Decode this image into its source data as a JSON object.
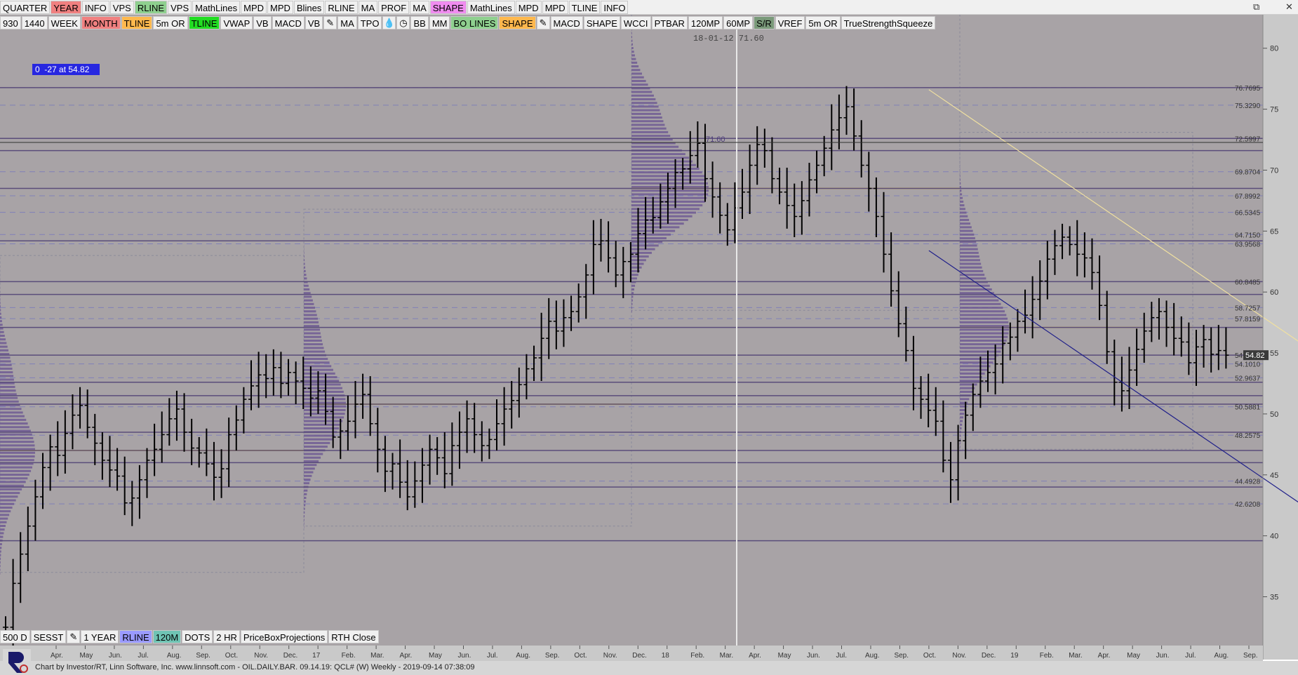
{
  "toolbar_top": [
    "QUARTER",
    "YEAR",
    "INFO",
    "VPS",
    "RLINE",
    "VPS",
    "MathLines",
    "MPD",
    "MPD",
    "Blines",
    "RLINE",
    "MA",
    "PROF",
    "MA",
    "SHAPE",
    "MathLines",
    "MPD",
    "MPD",
    "TLINE",
    "INFO"
  ],
  "toolbar_top_colors": [
    "",
    "red",
    "",
    "",
    "green",
    "",
    "",
    "",
    "",
    "",
    "",
    "",
    "",
    "",
    "magenta",
    "",
    "",
    "",
    "",
    ""
  ],
  "toolbar_second": [
    "930",
    "1440",
    "WEEK",
    "MONTH",
    "TLINE",
    "5m OR",
    "TLINE",
    "VWAP",
    "VB",
    "MACD",
    "VB",
    "pencil-icon",
    "MA",
    "TPO",
    "drop-icon",
    "clock-icon",
    "BB",
    "MM",
    "BO LINES",
    "SHAPE",
    "pencil-icon",
    "MACD",
    "SHAPE",
    "WCCI",
    "PTBAR",
    "120MP",
    "60MP",
    "S/R",
    "VREF",
    "5m OR",
    "TrueStrengthSqueeze"
  ],
  "toolbar_second_colors": [
    "",
    "",
    "",
    "red",
    "orange",
    "",
    "green",
    "",
    "",
    "",
    "",
    "",
    "",
    "",
    "",
    "",
    "",
    "",
    "green",
    "orange",
    "",
    "",
    "",
    "",
    "",
    "",
    "",
    "dgreen",
    "",
    "",
    ""
  ],
  "toolbar_bottom": [
    "500 D",
    "SESST",
    "pencil-icon",
    "1 YEAR",
    "RLINE",
    "120M",
    "DOTS",
    "2 HR",
    "PriceBoxProjections",
    "RTH Close"
  ],
  "toolbar_bottom_colors": [
    "",
    "",
    "",
    "",
    "blue",
    "teal",
    "",
    "",
    "",
    ""
  ],
  "window_controls": [
    "restore-icon",
    "close-icon"
  ],
  "info_box": "0  -27 at 54.82",
  "crosshair_label": "18-01-12  71.60",
  "footer": "Chart by Investor/RT, Linn Software, Inc. www.linnsoft.com - OIL.DAILY.BAR.  09.14.19: QCL# (W) Weekly - 2019-09-14 07:38:09",
  "chart_data": {
    "type": "bar",
    "subtype": "ohlc-weekly-with-volume-profile",
    "instrument": "QCL#",
    "ylim": [
      31,
      82
    ],
    "y_ticks": [
      35,
      40,
      45,
      50,
      55,
      60,
      65,
      70,
      75,
      80
    ],
    "price_level_labels": [
      "76.7695",
      "75.3290",
      "72.5997",
      "69.8704",
      "67.8992",
      "66.5345",
      "64.7150",
      "63.9568",
      "60.8485",
      "58.7257",
      "57.8159",
      "54.8200",
      "54.1010",
      "52.9637",
      "50.5881",
      "48.2575",
      "44.4928",
      "42.6208"
    ],
    "last_price": "54.82",
    "crosshair_price_label": "71.60",
    "x_tick_labels": [
      "Apr.",
      "May",
      "Jun.",
      "Jul.",
      "Aug.",
      "Sep.",
      "Oct.",
      "Nov.",
      "Dec.",
      "17",
      "Feb.",
      "Mar.",
      "Apr.",
      "May",
      "Jun.",
      "Jul.",
      "Aug.",
      "Sep.",
      "Oct.",
      "Nov.",
      "Dec.",
      "18",
      "Feb.",
      "Mar.",
      "Apr.",
      "May",
      "Jun.",
      "Jul.",
      "Aug.",
      "Sep.",
      "Oct.",
      "Nov.",
      "Dec.",
      "19",
      "Feb.",
      "Mar.",
      "Apr.",
      "May",
      "Jun.",
      "Jul.",
      "Aug.",
      "Sep."
    ],
    "weekly_closes": [
      32.5,
      36.1,
      38.5,
      40.8,
      43.2,
      45.6,
      47.3,
      46.6,
      48.4,
      49.9,
      50.7,
      48.9,
      47.6,
      46.2,
      45.4,
      44.9,
      42.7,
      43.1,
      44.6,
      46.2,
      47.1,
      48.3,
      49.6,
      50.4,
      48.5,
      47.2,
      46.8,
      45.9,
      44.8,
      45.5,
      48.3,
      49.5,
      51.2,
      52.3,
      53.2,
      52.9,
      53.8,
      52.5,
      53.4,
      52.7,
      52.1,
      51.3,
      51.9,
      50.2,
      48.1,
      48.6,
      49.4,
      50.8,
      51.6,
      49.2,
      47.1,
      45.3,
      45.9,
      44.4,
      43.2,
      44.5,
      45.8,
      47.1,
      46.4,
      45.1,
      47.4,
      48.5,
      49.6,
      48.3,
      47.4,
      47.9,
      49.2,
      50.4,
      51.1,
      52.4,
      53.7,
      54.6,
      56.2,
      57.6,
      56.8,
      57.9,
      58.4,
      59.6,
      61.4,
      63.9,
      64.2,
      62.8,
      61.4,
      62.5,
      63.1,
      64.8,
      65.9,
      66.1,
      67.4,
      68.5,
      69.8,
      70.1,
      71.2,
      72.2,
      69.3,
      67.8,
      66.3,
      65.1,
      66.9,
      68.2,
      70.4,
      72.1,
      71.6,
      69.3,
      68.2,
      67.1,
      66.2,
      67.5,
      69.2,
      70.4,
      71.8,
      73.3,
      74.3,
      75.2,
      72.8,
      70.4,
      68.5,
      66.2,
      63.1,
      60.1,
      57.4,
      55.2,
      52.1,
      51.2,
      50.3,
      49.4,
      46.2,
      44.6,
      47.8,
      49.9,
      51.6,
      52.7,
      53.4,
      54.1,
      55.8,
      56.3,
      57.6,
      58.1,
      59.4,
      60.9,
      62.7,
      63.8,
      64.5,
      63.9,
      63.1,
      62.8,
      61.6,
      58.9,
      55.1,
      52.6,
      51.9,
      53.6,
      55.3,
      56.8,
      57.9,
      58.4,
      57.1,
      56.2,
      55.9,
      54.2,
      55.5,
      56.1,
      54.9,
      55.2,
      54.82
    ],
    "volume_profile_pocs": [
      47.0,
      50.8,
      68.5,
      57.1
    ],
    "horizontal_levels": [
      76.77,
      72.6,
      71.6,
      68.5,
      64.2,
      60.85,
      59.8,
      57.1,
      54.82,
      52.6,
      51.5,
      50.8,
      48.5,
      47.0,
      46.0,
      44.0,
      39.6
    ],
    "trendlines": [
      {
        "name": "resistance",
        "from_label": "Oct.",
        "from_price": 76.6,
        "to_label": "Sep.",
        "to_price": 55.0
      },
      {
        "name": "support",
        "from_label": "Oct.",
        "from_price": 63.4,
        "to_label": "Sep.",
        "to_price": 41.8
      }
    ]
  }
}
